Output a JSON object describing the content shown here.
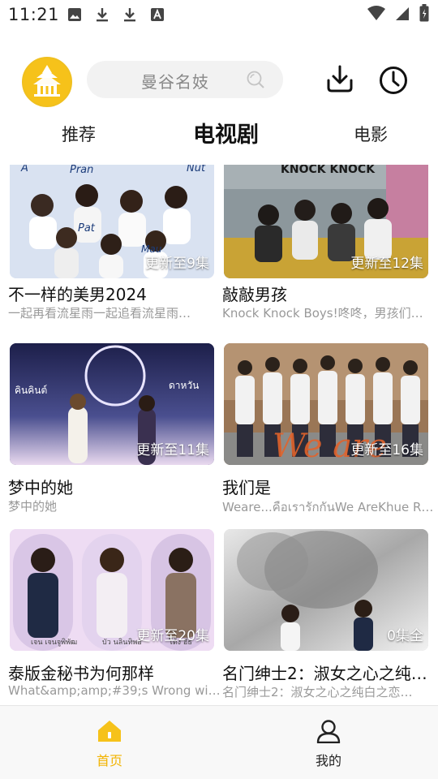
{
  "status_bar": {
    "time": "11:21",
    "left_icons": [
      "image-icon",
      "download-arrow-icon",
      "download-arrow-icon",
      "text-a-icon"
    ],
    "right_icons": [
      "wifi-icon",
      "signal-icon",
      "battery-icon"
    ]
  },
  "header": {
    "logo_icon": "temple-logo-icon",
    "search": {
      "text": "曼谷名妓",
      "icon": "search-icon"
    },
    "download_icon": "download-tray-icon",
    "history_icon": "clock-icon"
  },
  "tabs": [
    {
      "label": "推荐",
      "active": false
    },
    {
      "label": "电视剧",
      "active": true
    },
    {
      "label": "电影",
      "active": false
    }
  ],
  "cards": [
    {
      "title": "不一样的美男2024",
      "subtitle": "一起再看流星雨一起追看流星雨…",
      "badge": "更新至9集",
      "poster_colors": [
        "#c9d6ea",
        "#ffffff"
      ]
    },
    {
      "title": "敲敲男孩",
      "subtitle": "Knock Knock Boys!咚咚，男孩们…",
      "badge": "更新至12集",
      "poster_colors": [
        "#7a8790",
        "#caa23a"
      ]
    },
    {
      "title": "梦中的她",
      "subtitle": "梦中的她",
      "badge": "更新至11集",
      "poster_colors": [
        "#2a2a5e",
        "#d8c6e6"
      ]
    },
    {
      "title": "我们是",
      "subtitle": "Weare...คือเรารักกันWe AreKhue R…",
      "badge": "更新至16集",
      "poster_colors": [
        "#8a6a4a",
        "#e07a3a"
      ]
    },
    {
      "title": "泰版金秘书为何那样",
      "subtitle": "What&amp;amp;#39;s Wrong wi…",
      "badge": "更新至20集",
      "poster_colors": [
        "#e9d6ef",
        "#f5e7f5"
      ]
    },
    {
      "title": "名门绅士2：淑女之心之纯…",
      "subtitle": "名门绅士2：淑女之心之纯白之恋…",
      "badge": "0集全",
      "poster_colors": [
        "#9a9a9a",
        "#e6e6e6"
      ]
    }
  ],
  "bottom_nav": [
    {
      "label": "首页",
      "icon": "home-icon",
      "active": true,
      "color": "#f2b300"
    },
    {
      "label": "我的",
      "icon": "user-icon",
      "active": false,
      "color": "#222222"
    }
  ]
}
